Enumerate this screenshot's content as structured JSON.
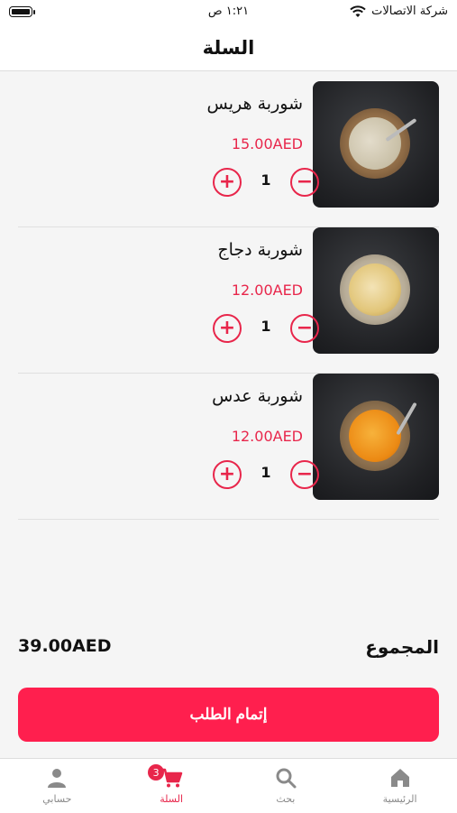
{
  "status": {
    "carrier": "شركة الاتصالات",
    "time": "١:٢١ ص"
  },
  "header": {
    "title": "السلة"
  },
  "cart": {
    "items": [
      {
        "name": "شوربة هريس",
        "price": "15.00AED",
        "quantity": "1"
      },
      {
        "name": "شوربة دجاج",
        "price": "12.00AED",
        "quantity": "1"
      },
      {
        "name": "شوربة عدس",
        "price": "12.00AED",
        "quantity": "1"
      }
    ],
    "total_label": "المجموع",
    "total_value": "39.00AED",
    "checkout_label": "إتمام الطلب"
  },
  "tabs": [
    {
      "label": "الرئيسية",
      "icon": "home-icon"
    },
    {
      "label": "بحث",
      "icon": "search-icon"
    },
    {
      "label": "السلة",
      "icon": "cart-icon",
      "badge": "3",
      "active": true
    },
    {
      "label": "حسابي",
      "icon": "user-icon"
    }
  ],
  "colors": {
    "accent": "#e8264b",
    "button": "#ff1f4e"
  }
}
